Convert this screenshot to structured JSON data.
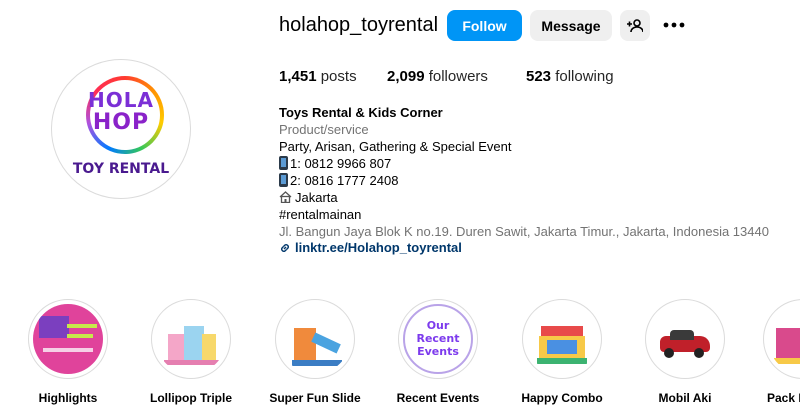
{
  "profile": {
    "username": "holahop_toyrental",
    "logo_word1": "HOLA",
    "logo_word2": "HOP",
    "logo_sub": "TOY RENTAL"
  },
  "actions": {
    "follow": "Follow",
    "message": "Message",
    "add_user_icon": "person-add-icon",
    "more_icon": "more-icon"
  },
  "stats": {
    "posts_count": "1,451",
    "posts_label": "posts",
    "followers_count": "2,099",
    "followers_label": "followers",
    "following_count": "523",
    "following_label": "following"
  },
  "bio": {
    "name": "Toys Rental & Kids Corner",
    "category": "Product/service",
    "line1": "Party, Arisan, Gathering & Special Event",
    "line2": "1: 0812 9966 807",
    "line3": "2: 0816 1777 2408",
    "line4": "Jakarta",
    "line5": "#rentalmainan",
    "address": "Jl. Bangun Jaya Blok K no.19. Duren Sawit, Jakarta Timur., Jakarta, Indonesia 13440",
    "link": "linktr.ee/Holahop_toyrental"
  },
  "highlights": [
    {
      "label": "Highlights",
      "thumb": "#e0439b"
    },
    {
      "label": "Lollipop Triple",
      "thumb": "#f4a6c8"
    },
    {
      "label": "Super Fun Slide",
      "thumb": "#f08a3c"
    },
    {
      "label": "Recent Events",
      "thumb": "#7c3aed",
      "text1": "Our",
      "text2": "Recent",
      "text3": "Events"
    },
    {
      "label": "Happy Combo",
      "thumb": "#e84a4a"
    },
    {
      "label": "Mobil Aki",
      "thumb": "#c0202a"
    },
    {
      "label": "Pack M",
      "thumb": "#d94a8c"
    }
  ]
}
